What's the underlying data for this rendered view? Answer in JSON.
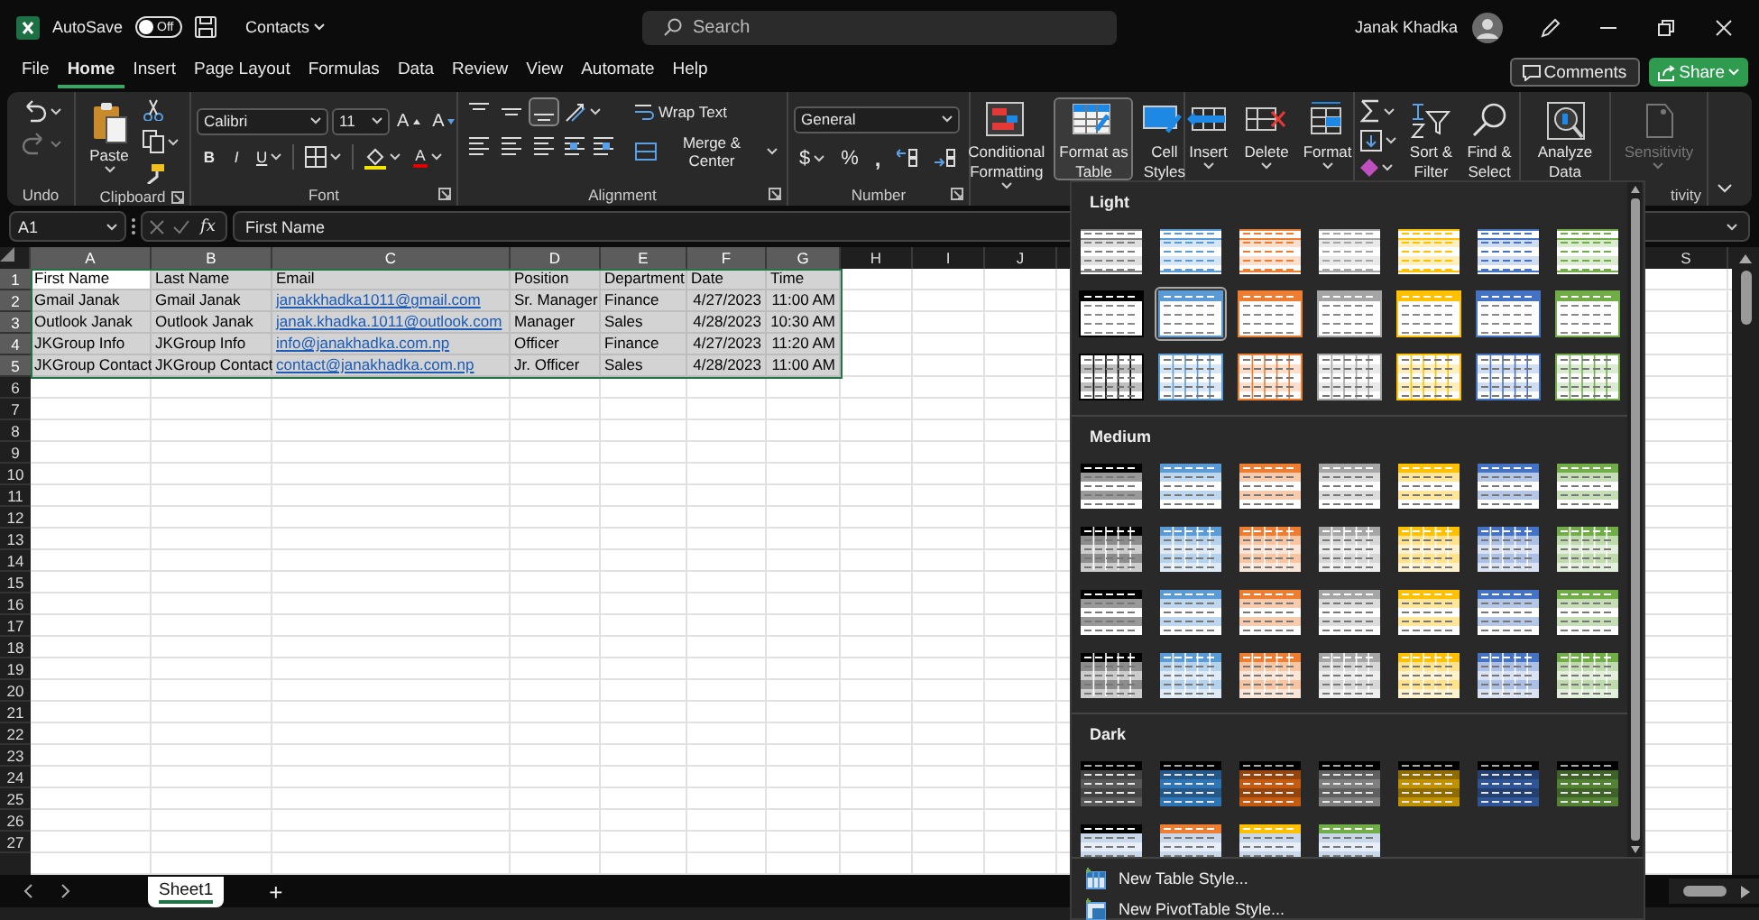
{
  "title_bar": {
    "autosave_label": "AutoSave",
    "autosave": {
      "on": false,
      "label": "Off"
    },
    "document": "Contacts",
    "search": {
      "placeholder": "Search"
    },
    "user": "Janak Khadka"
  },
  "menu": {
    "tabs": [
      {
        "label": "File",
        "selected": false
      },
      {
        "label": "Home",
        "selected": true
      },
      {
        "label": "Insert",
        "selected": false
      },
      {
        "label": "Page Layout",
        "selected": false
      },
      {
        "label": "Formulas",
        "selected": false
      },
      {
        "label": "Data",
        "selected": false
      },
      {
        "label": "Review",
        "selected": false
      },
      {
        "label": "View",
        "selected": false
      },
      {
        "label": "Automate",
        "selected": false
      },
      {
        "label": "Help",
        "selected": false
      }
    ],
    "comments": "Comments",
    "share": "Share"
  },
  "ribbon": {
    "groups": [
      {
        "kind": "undo",
        "label": "Undo"
      },
      {
        "kind": "clipboard",
        "label": "Clipboard",
        "paste": "Paste"
      },
      {
        "kind": "font",
        "label": "Font",
        "font_name": "Calibri",
        "font_size": "11",
        "grow": "A",
        "shrink": "A",
        "bold": "B",
        "italic": "I",
        "underline": "U",
        "font_color": "A"
      },
      {
        "kind": "alignment",
        "label": "Alignment",
        "vertical": [
          {
            "on": false
          },
          {
            "on": false
          },
          {
            "on": true
          }
        ],
        "wrap_text": "Wrap Text",
        "merge": "Merge & Center"
      },
      {
        "kind": "number",
        "label": "Number",
        "format": "General",
        "currency": "$",
        "percent": "%",
        "comma": ","
      },
      {
        "kind": "styles",
        "buttons": [
          {
            "lines": [
              "Conditional",
              "Formatting"
            ],
            "pressed": false
          },
          {
            "lines": [
              "Format as",
              "Table"
            ],
            "pressed": true
          },
          {
            "lines": [
              "Cell",
              "Styles"
            ],
            "pressed": false
          }
        ]
      },
      {
        "kind": "cells",
        "buttons": [
          {
            "lines": [
              "Insert"
            ]
          },
          {
            "lines": [
              "Delete"
            ]
          },
          {
            "lines": [
              "Format"
            ]
          }
        ]
      },
      {
        "kind": "editing",
        "buttons": [
          {
            "lines": [
              "Sort &",
              "Filter"
            ]
          },
          {
            "lines": [
              "Find &",
              "Select"
            ]
          }
        ]
      },
      {
        "kind": "analysis",
        "buttons": [
          {
            "lines": [
              "Analyze",
              "Data"
            ]
          }
        ]
      },
      {
        "kind": "sensitivity",
        "label": "tivity",
        "buttons": [
          {
            "lines": [
              "Sensitivity"
            ],
            "disabled": true
          }
        ]
      }
    ]
  },
  "formula_bar": {
    "name_box": "A1",
    "fx": "fx",
    "value": "First Name"
  },
  "sheet": {
    "columns": [
      {
        "label": "A",
        "kind": "text",
        "selected": true
      },
      {
        "label": "B",
        "kind": "text",
        "selected": true
      },
      {
        "label": "C",
        "kind": "link",
        "selected": true
      },
      {
        "label": "D",
        "kind": "text",
        "selected": true
      },
      {
        "label": "E",
        "kind": "text",
        "selected": true
      },
      {
        "label": "F",
        "kind": "number",
        "selected": true
      },
      {
        "label": "G",
        "kind": "number",
        "selected": true
      },
      {
        "label": "H",
        "selected": false
      },
      {
        "label": "I",
        "selected": false
      },
      {
        "label": "J",
        "selected": false
      },
      {
        "label": "S",
        "selected": false
      }
    ],
    "rows": [
      {
        "number": "1",
        "kind": "header",
        "selected": true,
        "cells": [
          "First Name",
          "Last Name",
          "Email",
          "Position",
          "Department",
          "Date",
          "Time"
        ]
      },
      {
        "number": "2",
        "kind": "data",
        "selected": true,
        "cells": [
          "Gmail Janak",
          "Gmail Janak",
          "janakkhadka1011@gmail.com",
          "Sr. Manager",
          "Finance",
          "4/27/2023",
          "11:00 AM"
        ]
      },
      {
        "number": "3",
        "kind": "data",
        "selected": true,
        "cells": [
          "Outlook Janak",
          "Outlook Janak",
          "janak.khadka.1011@outlook.com",
          "Manager",
          "Sales",
          "4/28/2023",
          "10:30 AM"
        ]
      },
      {
        "number": "4",
        "kind": "data",
        "selected": true,
        "cells": [
          "JKGroup Info",
          "JKGroup Info",
          "info@janakhadka.com.np",
          "Officer",
          "Finance",
          "4/27/2023",
          "11:20 AM"
        ]
      },
      {
        "number": "5",
        "kind": "data",
        "selected": true,
        "cells": [
          "JKGroup Contact",
          "JKGroup Contact",
          "contact@janakhadka.com.np",
          "Jr. Officer",
          "Sales",
          "4/28/2023",
          "11:00 AM"
        ]
      },
      {
        "number": "6",
        "selected": false,
        "cells": []
      },
      {
        "number": "7",
        "selected": false,
        "cells": []
      },
      {
        "number": "8",
        "selected": false,
        "cells": []
      },
      {
        "number": "9",
        "selected": false,
        "cells": []
      },
      {
        "number": "10",
        "selected": false,
        "cells": []
      },
      {
        "number": "11",
        "selected": false,
        "cells": []
      },
      {
        "number": "12",
        "selected": false,
        "cells": []
      },
      {
        "number": "13",
        "selected": false,
        "cells": []
      },
      {
        "number": "14",
        "selected": false,
        "cells": []
      },
      {
        "number": "15",
        "selected": false,
        "cells": []
      },
      {
        "number": "16",
        "selected": false,
        "cells": []
      },
      {
        "number": "17",
        "selected": false,
        "cells": []
      },
      {
        "number": "18",
        "selected": false,
        "cells": []
      },
      {
        "number": "19",
        "selected": false,
        "cells": []
      },
      {
        "number": "20",
        "selected": false,
        "cells": []
      },
      {
        "number": "21",
        "selected": false,
        "cells": []
      },
      {
        "number": "22",
        "selected": false,
        "cells": []
      },
      {
        "number": "23",
        "selected": false,
        "cells": []
      },
      {
        "number": "24",
        "selected": false,
        "cells": []
      },
      {
        "number": "25",
        "selected": false,
        "cells": []
      },
      {
        "number": "26",
        "selected": false,
        "cells": []
      },
      {
        "number": "27",
        "selected": false,
        "cells": []
      }
    ]
  },
  "sheet_tabs": {
    "tabs": [
      {
        "label": "Sheet1",
        "selected": true
      }
    ],
    "add": "+"
  },
  "gallery": {
    "sections": [
      {
        "title": "Light",
        "swatches": [
          {
            "kind": "light",
            "color": "#7f7f7f",
            "selected": false
          },
          {
            "kind": "light",
            "color": "#5b9bd5",
            "selected": false
          },
          {
            "kind": "light",
            "color": "#ed7d31",
            "selected": false
          },
          {
            "kind": "light",
            "color": "#a5a5a5",
            "selected": false
          },
          {
            "kind": "light",
            "color": "#ffc000",
            "selected": false
          },
          {
            "kind": "light",
            "color": "#4472c4",
            "selected": false
          },
          {
            "kind": "light",
            "color": "#70ad47",
            "selected": false
          },
          {
            "kind": "header",
            "color": "#000000",
            "selected": false
          },
          {
            "kind": "header",
            "color": "#5b9bd5",
            "selected": true
          },
          {
            "kind": "header",
            "color": "#ed7d31",
            "selected": false
          },
          {
            "kind": "header",
            "color": "#a5a5a5",
            "selected": false
          },
          {
            "kind": "header",
            "color": "#ffc000",
            "selected": false
          },
          {
            "kind": "header",
            "color": "#4472c4",
            "selected": false
          },
          {
            "kind": "header",
            "color": "#70ad47",
            "selected": false
          },
          {
            "kind": "grid",
            "color": "#000000",
            "selected": false
          },
          {
            "kind": "grid",
            "color": "#5b9bd5",
            "selected": false
          },
          {
            "kind": "grid",
            "color": "#ed7d31",
            "selected": false
          },
          {
            "kind": "grid",
            "color": "#a5a5a5",
            "selected": false
          },
          {
            "kind": "grid",
            "color": "#ffc000",
            "selected": false
          },
          {
            "kind": "grid",
            "color": "#4472c4",
            "selected": false
          },
          {
            "kind": "grid",
            "color": "#70ad47",
            "selected": false
          }
        ]
      },
      {
        "title": "Medium",
        "swatches": [
          {
            "kind": "medium",
            "color": "#000000",
            "selected": false
          },
          {
            "kind": "medium",
            "color": "#5b9bd5",
            "selected": false
          },
          {
            "kind": "medium",
            "color": "#ed7d31",
            "selected": false
          },
          {
            "kind": "medium",
            "color": "#a5a5a5",
            "selected": false
          },
          {
            "kind": "medium",
            "color": "#ffc000",
            "selected": false
          },
          {
            "kind": "medium",
            "color": "#4472c4",
            "selected": false
          },
          {
            "kind": "medium",
            "color": "#70ad47",
            "selected": false
          },
          {
            "kind": "medium-grid",
            "color": "#000000",
            "selected": false
          },
          {
            "kind": "medium-grid",
            "color": "#5b9bd5",
            "selected": false
          },
          {
            "kind": "medium-grid",
            "color": "#ed7d31",
            "selected": false
          },
          {
            "kind": "medium-grid",
            "color": "#a5a5a5",
            "selected": false
          },
          {
            "kind": "medium-grid",
            "color": "#ffc000",
            "selected": false
          },
          {
            "kind": "medium-grid",
            "color": "#4472c4",
            "selected": false
          },
          {
            "kind": "medium-grid",
            "color": "#70ad47",
            "selected": false
          },
          {
            "kind": "medium",
            "color": "#000000",
            "selected": false
          },
          {
            "kind": "medium",
            "color": "#5b9bd5",
            "selected": false
          },
          {
            "kind": "medium",
            "color": "#ed7d31",
            "selected": false
          },
          {
            "kind": "medium",
            "color": "#a5a5a5",
            "selected": false
          },
          {
            "kind": "medium",
            "color": "#ffc000",
            "selected": false
          },
          {
            "kind": "medium",
            "color": "#4472c4",
            "selected": false
          },
          {
            "kind": "medium",
            "color": "#70ad47",
            "selected": false
          },
          {
            "kind": "medium-grid",
            "color": "#000000",
            "selected": false
          },
          {
            "kind": "medium-grid",
            "color": "#5b9bd5",
            "selected": false
          },
          {
            "kind": "medium-grid",
            "color": "#ed7d31",
            "selected": false
          },
          {
            "kind": "medium-grid",
            "color": "#a5a5a5",
            "selected": false
          },
          {
            "kind": "medium-grid",
            "color": "#ffc000",
            "selected": false
          },
          {
            "kind": "medium-grid",
            "color": "#4472c4",
            "selected": false
          },
          {
            "kind": "medium-grid",
            "color": "#70ad47",
            "selected": false
          }
        ]
      },
      {
        "title": "Dark",
        "swatches": [
          {
            "kind": "dark",
            "color": "#595959",
            "selected": false
          },
          {
            "kind": "dark",
            "color": "#2e75b6",
            "selected": false
          },
          {
            "kind": "dark",
            "color": "#c55a11",
            "selected": false
          },
          {
            "kind": "dark",
            "color": "#7f7f7f",
            "selected": false
          },
          {
            "kind": "dark",
            "color": "#bf9000",
            "selected": false
          },
          {
            "kind": "dark",
            "color": "#2f5597",
            "selected": false
          },
          {
            "kind": "dark",
            "color": "#548235",
            "selected": false
          },
          {
            "kind": "dark-header",
            "color": "#000000",
            "selected": false
          },
          {
            "kind": "dark-header",
            "color": "#ed7d31",
            "selected": false
          },
          {
            "kind": "dark-header",
            "color": "#ffc000",
            "selected": false
          },
          {
            "kind": "dark-header",
            "color": "#70ad47",
            "selected": false
          }
        ]
      }
    ],
    "actions": [
      "New Table Style...",
      "New PivotTable Style..."
    ]
  }
}
